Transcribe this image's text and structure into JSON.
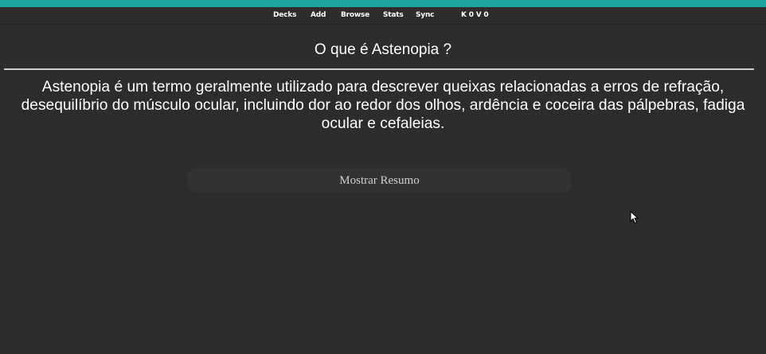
{
  "toolbar": {
    "links": [
      "Decks",
      "Add",
      "Browse",
      "Stats",
      "Sync"
    ],
    "counts": "K 0 V 0"
  },
  "card": {
    "question": "O que é Astenopia ?",
    "answer": "Astenopia é um termo geralmente utilizado para descrever queixas relacionadas a erros de refração, desequilíbrio do músculo ocular, incluindo dor ao redor dos olhos, ardência e coceira das pálpebras, fadiga ocular e cefaleias."
  },
  "reveal_button_label": "Mostrar Resumo",
  "colors": {
    "accent": "#1ba39c",
    "background": "#2c2c2c",
    "button_bg": "#323232",
    "divider": "#cfcfcf"
  },
  "icons": [
    "mouse-pointer-icon"
  ]
}
